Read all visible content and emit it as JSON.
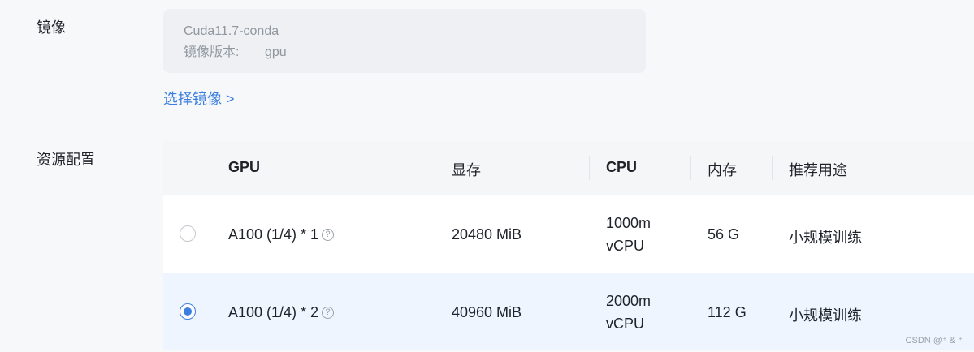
{
  "image_section": {
    "label": "镜像",
    "image_name": "Cuda11.7-conda",
    "version_label": "镜像版本:",
    "version_value": "gpu",
    "select_link": "选择镜像 >"
  },
  "resource_section": {
    "label": "资源配置",
    "columns": {
      "gpu": "GPU",
      "memory": "显存",
      "cpu": "CPU",
      "ram": "内存",
      "usage": "推荐用途"
    },
    "rows": [
      {
        "selected": false,
        "gpu": "A100 (1/4) * 1",
        "memory": "20480 MiB",
        "cpu_line1": "1000m",
        "cpu_line2": "vCPU",
        "ram": "56 G",
        "usage": "小规模训练"
      },
      {
        "selected": true,
        "gpu": "A100 (1/4) * 2",
        "memory": "40960 MiB",
        "cpu_line1": "2000m",
        "cpu_line2": "vCPU",
        "ram": "112 G",
        "usage": "小规模训练"
      }
    ]
  },
  "help_icon_glyph": "?",
  "watermark": "CSDN @⁺ & ⁺",
  "colors": {
    "accent": "#3d7fe0",
    "selected_row_bg": "#eef5ff",
    "page_bg": "#f7f8fa"
  }
}
